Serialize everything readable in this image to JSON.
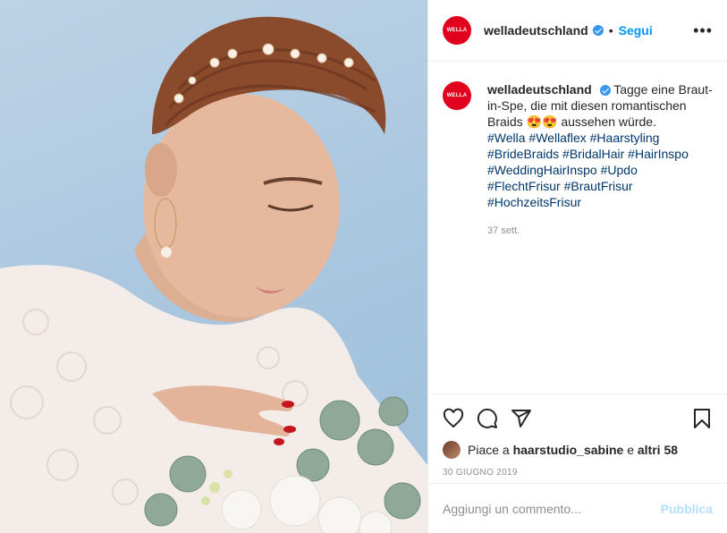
{
  "post": {
    "username": "welladeutschland",
    "follow_label": "Segui",
    "more_label": "•••",
    "logo_text": "WELLA",
    "caption": {
      "username": "welladeutschland",
      "text": "Tagge eine Braut-in-Spe, die mit diesen romantischen Braids 😍😍 aussehen würde.",
      "hashtags": "#Wella #Wellaflex #Haarstyling #BrideBraids #BridalHair #HairInspo #WeddingHairInspo #Updo #FlechtFrisur #BrautFrisur #HochzeitsFrisur"
    },
    "time_ago": "37 sett.",
    "likes": {
      "prefix": "Piace a",
      "user": "haarstudio_sabine",
      "middle": "e",
      "others": "altri 58"
    },
    "date": "30 GIUGNO 2019",
    "comment_placeholder": "Aggiungi un commento...",
    "post_label": "Pubblica"
  },
  "colors": {
    "brand_red": "#e1001e",
    "link_blue": "#0095f6",
    "verified_blue": "#3897f0"
  },
  "icons": [
    "heart-icon",
    "comment-icon",
    "share-icon",
    "bookmark-icon",
    "verified-badge-icon",
    "more-icon"
  ]
}
